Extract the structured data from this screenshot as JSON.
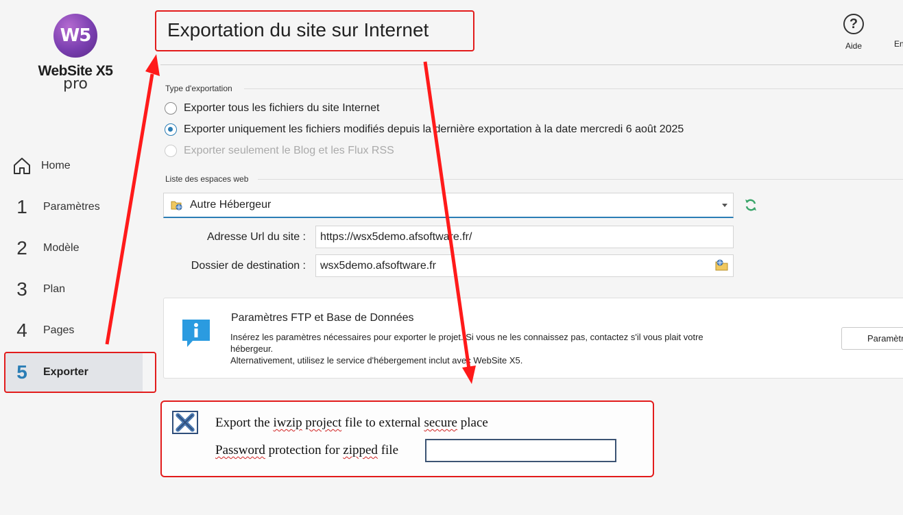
{
  "app": {
    "logo_mark": "W5",
    "logo_name": "WebSite X5",
    "logo_edition": "pro"
  },
  "sidebar": {
    "items": [
      {
        "num": "",
        "label": "Home",
        "icon": "home-icon"
      },
      {
        "num": "1",
        "label": "Paramètres"
      },
      {
        "num": "2",
        "label": "Modèle"
      },
      {
        "num": "3",
        "label": "Plan"
      },
      {
        "num": "4",
        "label": "Pages"
      },
      {
        "num": "5",
        "label": "Exporter",
        "active": true
      }
    ]
  },
  "header": {
    "title": "Exportation du site sur Internet",
    "help_label": "Aide",
    "truncated_label": "En"
  },
  "export_type": {
    "section_label": "Type d'exportation",
    "options": [
      {
        "label": "Exporter tous les fichiers du site Internet",
        "checked": false,
        "disabled": false
      },
      {
        "label": "Exporter uniquement les fichiers modifiés depuis la dernière exportation à la date mercredi 6 août 2025",
        "checked": true,
        "disabled": false
      },
      {
        "label": "Exporter seulement le Blog et les Flux RSS",
        "checked": false,
        "disabled": true
      }
    ]
  },
  "webspaces": {
    "section_label": "Liste des espaces web",
    "selected": "Autre Hébergeur",
    "url_label": "Adresse Url du site :",
    "url_value": "https://wsx5demo.afsoftware.fr/",
    "dest_label": "Dossier de destination :",
    "dest_value": "wsx5demo.afsoftware.fr"
  },
  "ftp": {
    "title": "Paramètres FTP et Base de Données",
    "line1": "Insérez les paramètres nécessaires pour exporter le projet. Si vous ne les connaissez pas, contactez s'il vous plait votre",
    "line2": "hébergeur.",
    "line3": "Alternativement, utilisez le service d'hébergement inclut avec WebSite X5.",
    "button_label": "Paramètres"
  },
  "annotation": {
    "export_prefix": "Export the ",
    "export_word1": "iwzip",
    "export_word2": "project",
    "export_mid": " file to external ",
    "export_word3": "secure",
    "export_suffix": " place",
    "pwd_word1": "Password",
    "pwd_mid": " protection for ",
    "pwd_word2": "zipped",
    "pwd_suffix": " file",
    "password_value": ""
  },
  "colors": {
    "accent": "#2a7db5",
    "annotation_red": "#e21b1b",
    "logo_purple": "#7a3fb0"
  }
}
